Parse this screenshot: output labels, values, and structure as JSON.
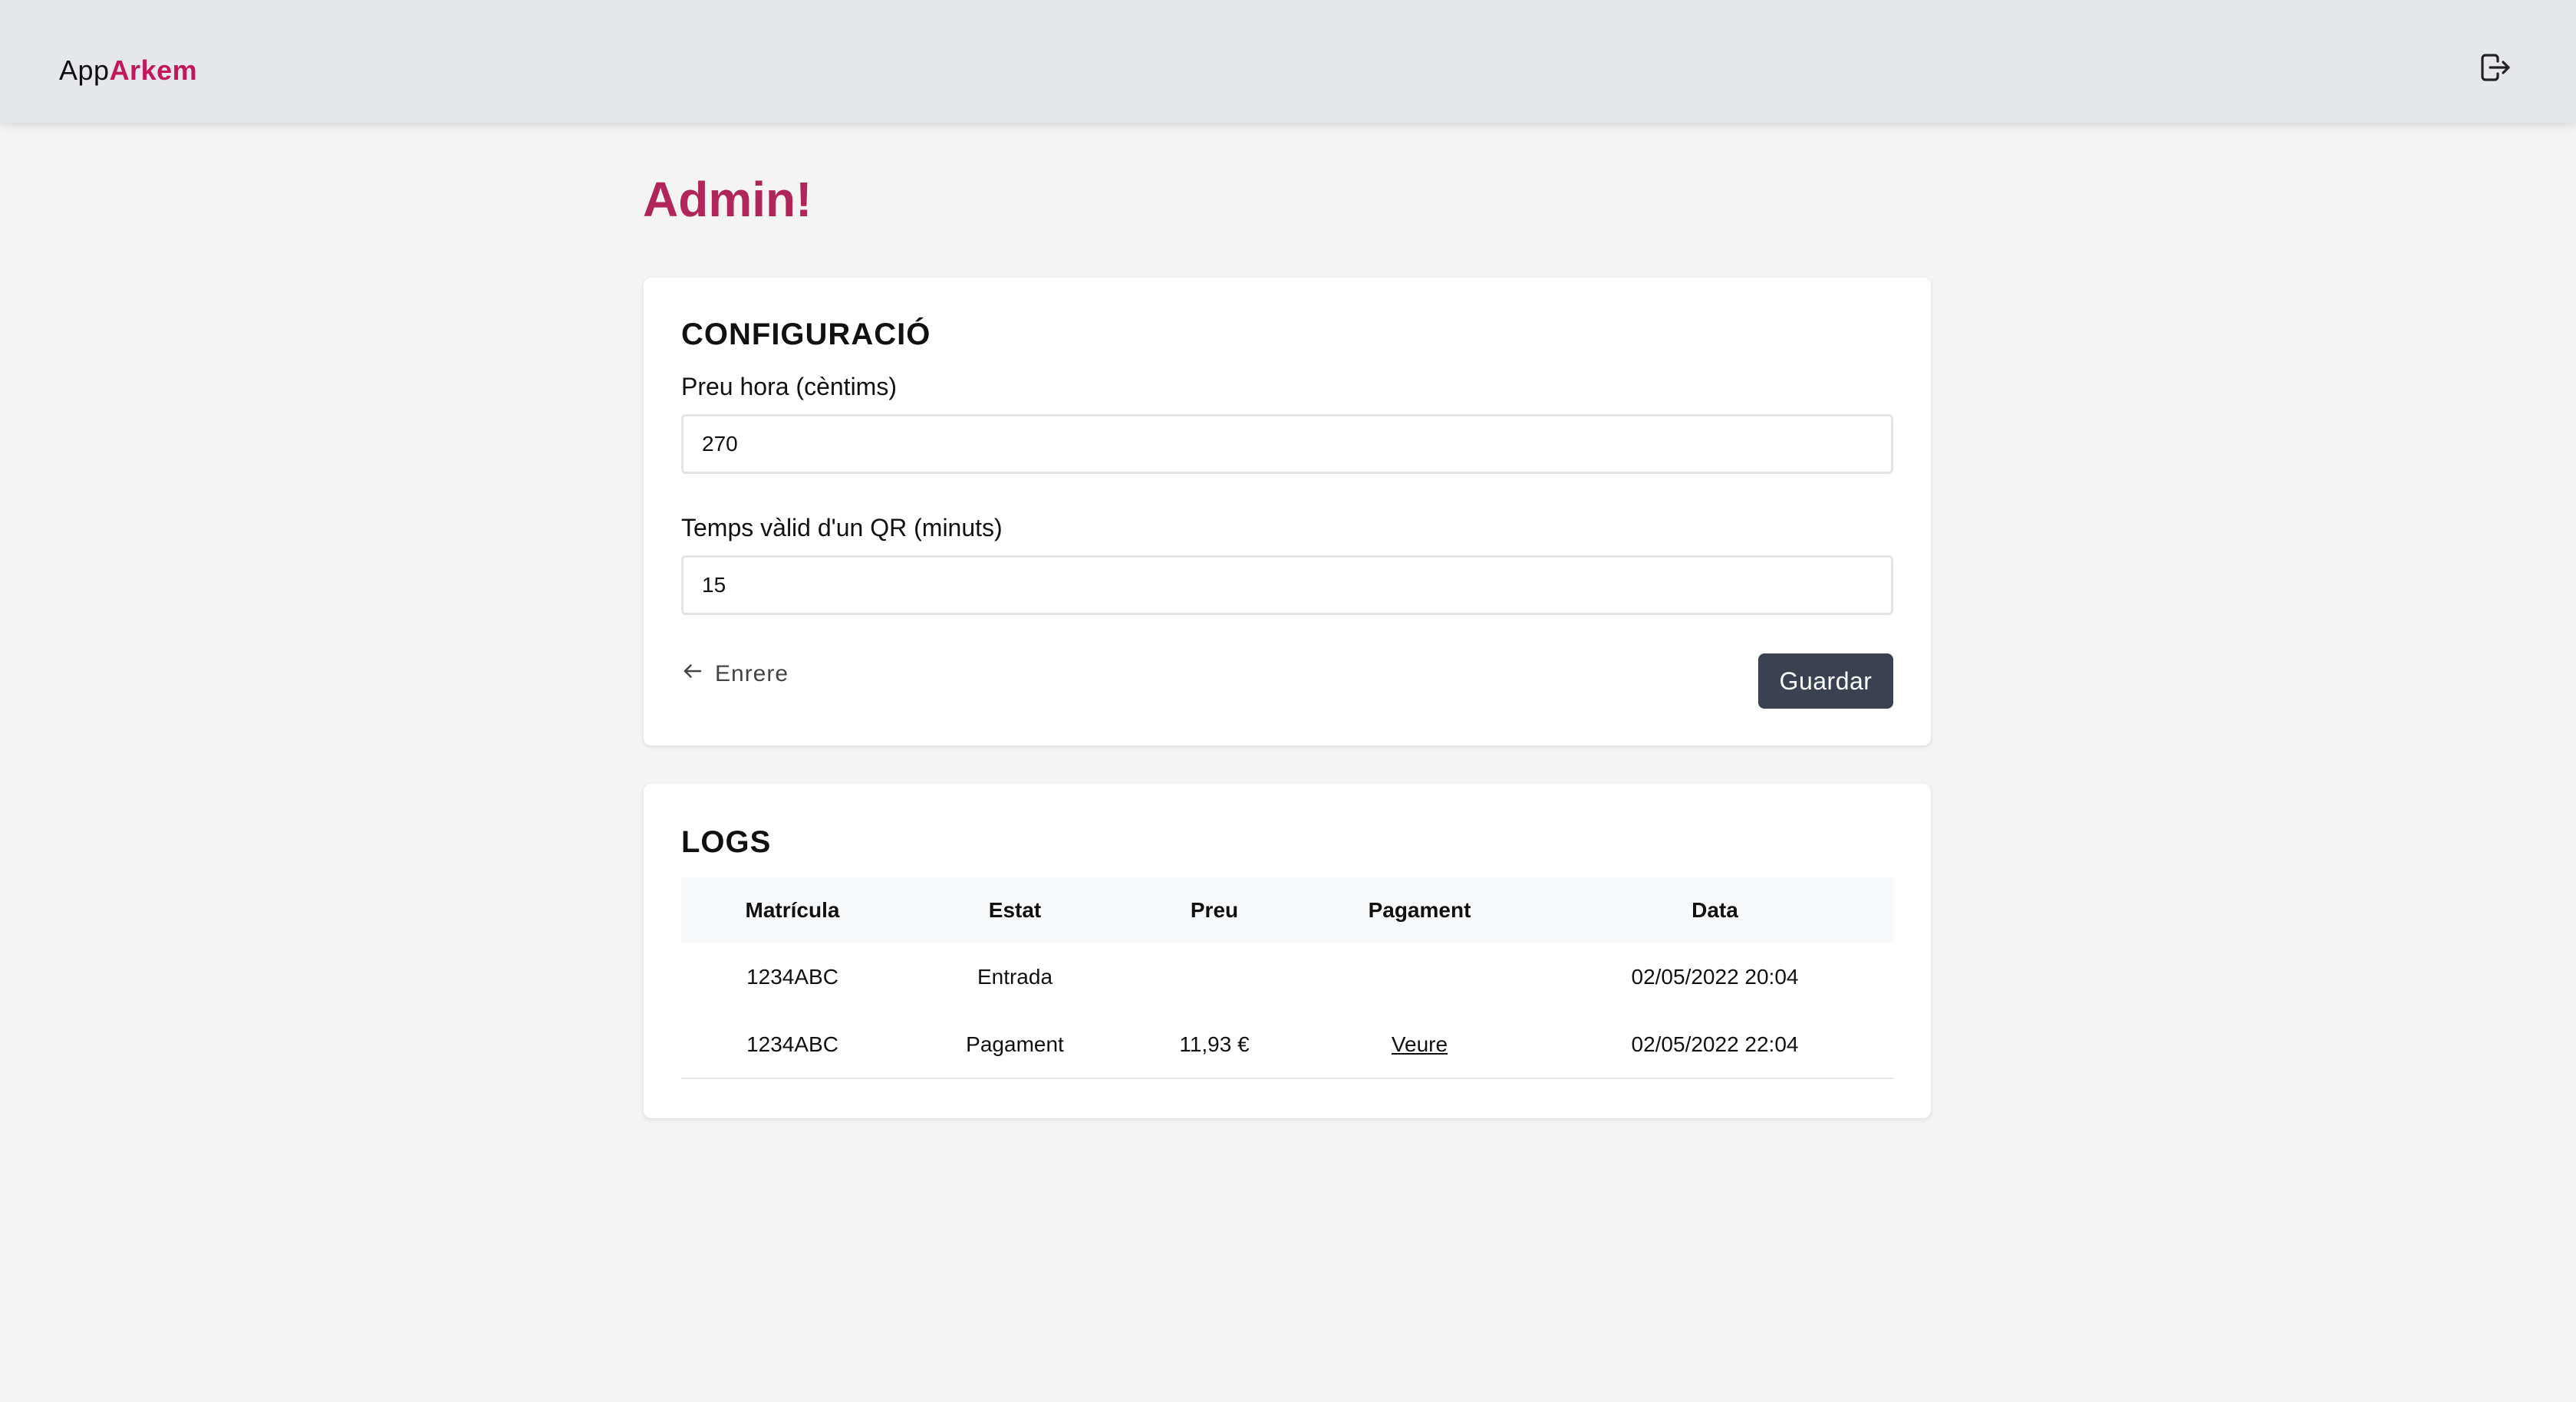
{
  "header": {
    "brand_app": "App",
    "brand_name": "Arkem",
    "logout_icon": "logout-icon"
  },
  "page": {
    "title": "Admin!"
  },
  "config": {
    "title": "CONFIGURACIÓ",
    "price_label": "Preu hora (cèntims)",
    "price_value": "270",
    "qr_label": "Temps vàlid d'un QR (minuts)",
    "qr_value": "15",
    "back_label": "Enrere",
    "save_label": "Guardar"
  },
  "logs": {
    "title": "LOGS",
    "columns": [
      "Matrícula",
      "Estat",
      "Preu",
      "Pagament",
      "Data"
    ],
    "rows": [
      {
        "plate": "1234ABC",
        "status": "Entrada",
        "price": "",
        "payment": "",
        "date": "02/05/2022 20:04"
      },
      {
        "plate": "1234ABC",
        "status": "Pagament",
        "price": "11,93 €",
        "payment": "Veure",
        "date": "02/05/2022 22:04"
      }
    ]
  },
  "colors": {
    "brand": "#c2185b",
    "title": "#b0265a",
    "button": "#3b4151"
  }
}
